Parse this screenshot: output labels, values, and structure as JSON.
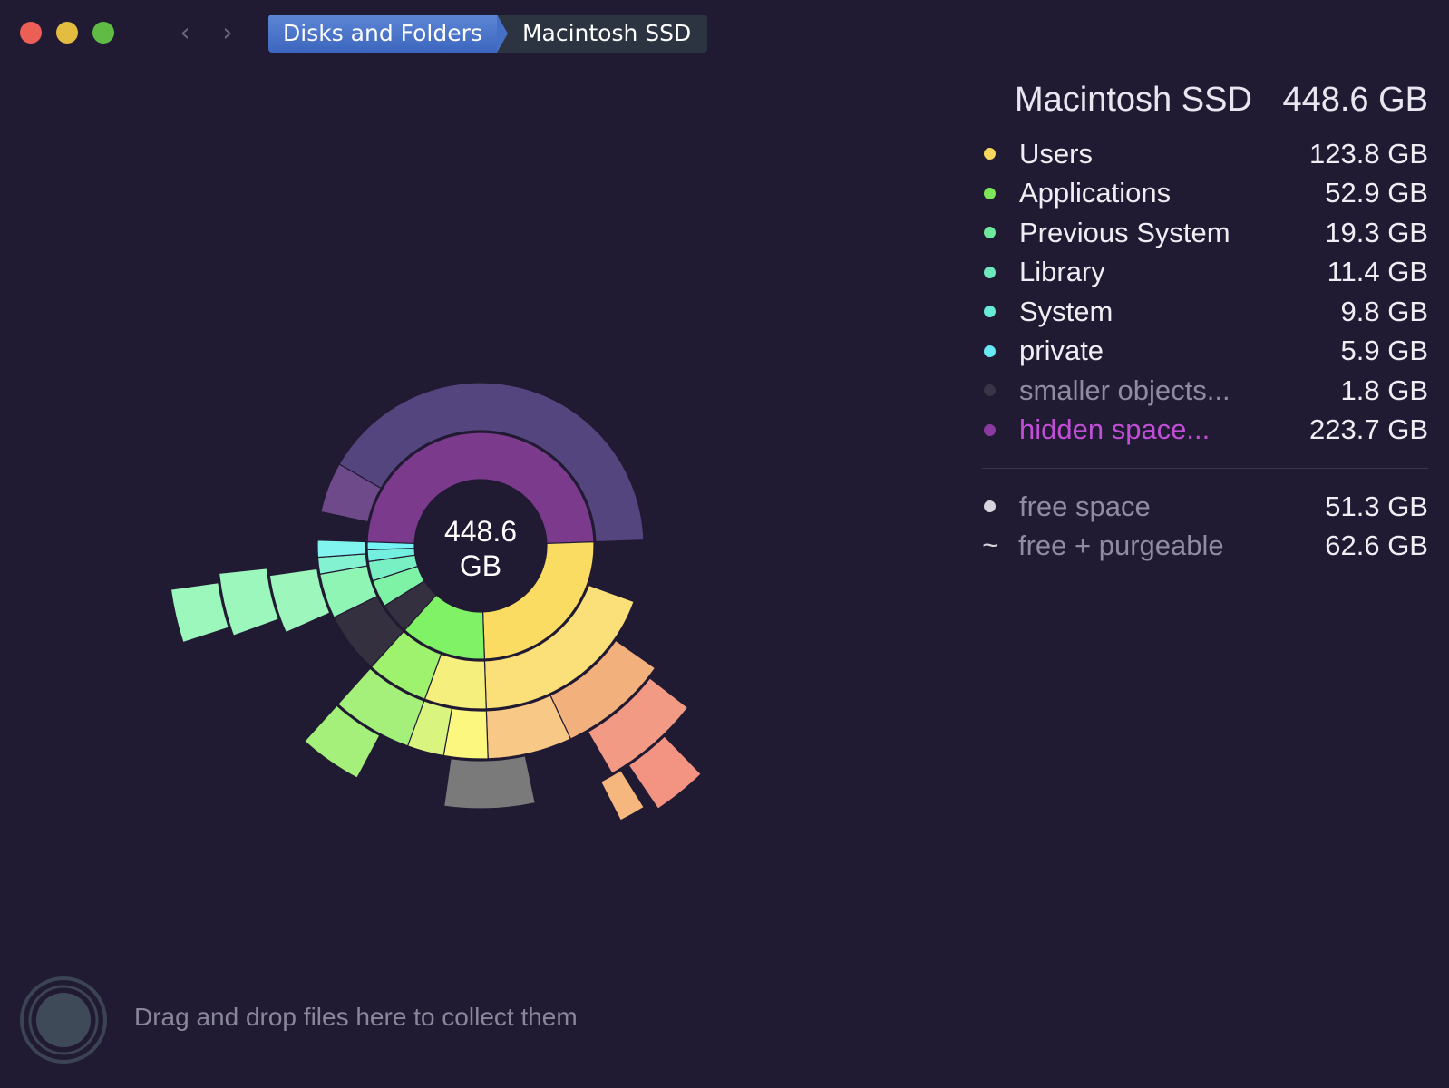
{
  "window": {
    "buttons": [
      "close",
      "minimize",
      "zoom"
    ]
  },
  "nav": {
    "back_icon": "chevron-left-icon",
    "back_glyph": "‹",
    "forward_icon": "chevron-right-icon",
    "forward_glyph": "›"
  },
  "breadcrumb": {
    "items": [
      {
        "label": "Disks and Folders"
      },
      {
        "label": "Macintosh SSD"
      }
    ]
  },
  "sunburst": {
    "center_value": "448.6",
    "center_unit": "GB"
  },
  "panel": {
    "title": "Macintosh SSD",
    "total": "448.6 GB",
    "items": [
      {
        "name": "Users",
        "size": "123.8 GB",
        "color": "#f8d85c"
      },
      {
        "name": "Applications",
        "size": "52.9 GB",
        "color": "#7ee559"
      },
      {
        "name": "Previous System",
        "size": "19.3 GB",
        "color": "#6fe79c"
      },
      {
        "name": "Library",
        "size": "11.4 GB",
        "color": "#6ee8bb"
      },
      {
        "name": "System",
        "size": "9.8 GB",
        "color": "#68ead8"
      },
      {
        "name": "private",
        "size": "5.9 GB",
        "color": "#66e9f2"
      },
      {
        "name": "smaller objects...",
        "size": "1.8 GB",
        "color": "#3a3446"
      },
      {
        "name": "hidden space...",
        "size": "223.7 GB",
        "color": "#8b3aa0"
      }
    ],
    "free": {
      "label": "free space",
      "size": "51.3 GB",
      "color": "#d7d5dc"
    },
    "purgeable": {
      "symbol": "~",
      "label": "free + purgeable",
      "size": "62.6 GB"
    }
  },
  "colors": {
    "background": "#211a33",
    "hidden_color": "#c04fd6",
    "muted_text": "#8f8ba0"
  },
  "footer": {
    "hint": "Drag and drop files here to collect them",
    "drop_icon": "collector-icon"
  }
}
